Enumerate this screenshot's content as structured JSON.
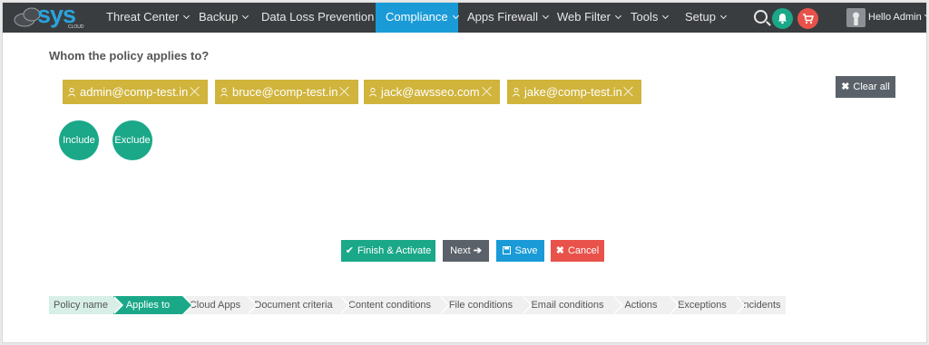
{
  "nav": {
    "logo_text": "sys",
    "logo_sub": "CLOUD",
    "items": [
      {
        "label": "Threat Center"
      },
      {
        "label": "Backup"
      },
      {
        "label": "Data Loss Prevention"
      },
      {
        "label": "Compliance",
        "active": true
      },
      {
        "label": "Apps Firewall"
      },
      {
        "label": "Web Filter"
      },
      {
        "label": "Tools"
      },
      {
        "label": "Setup"
      }
    ],
    "greeting": "Hello Admin"
  },
  "policy": {
    "heading": "Whom the policy applies to?",
    "recipients": [
      "admin@comp-test.in",
      "bruce@comp-test.in",
      "jack@awsseo.com",
      "jake@comp-test.in"
    ],
    "clear_all_label": "Clear all",
    "include_label": "Include",
    "exclude_label": "Exclude"
  },
  "actions": {
    "finish_label": "Finish & Activate",
    "next_label": "Next",
    "save_label": "Save",
    "cancel_label": "Cancel"
  },
  "steps": [
    {
      "label": "Policy name",
      "state": "done"
    },
    {
      "label": "Applies to",
      "state": "current"
    },
    {
      "label": "Cloud Apps",
      "state": "todo"
    },
    {
      "label": "Document criteria",
      "state": "todo"
    },
    {
      "label": "Content conditions",
      "state": "todo"
    },
    {
      "label": "File conditions",
      "state": "todo"
    },
    {
      "label": "Email conditions",
      "state": "todo"
    },
    {
      "label": "Actions",
      "state": "todo"
    },
    {
      "label": "Exceptions",
      "state": "todo"
    },
    {
      "label": "Incidents",
      "state": "todo"
    }
  ],
  "colors": {
    "nav_bg": "#3a3d40",
    "active": "#1a9bd7",
    "chip": "#d0b43c",
    "teal": "#1aa888",
    "dark_btn": "#5a6169",
    "save": "#1a9bd7",
    "cancel": "#e8524a"
  }
}
